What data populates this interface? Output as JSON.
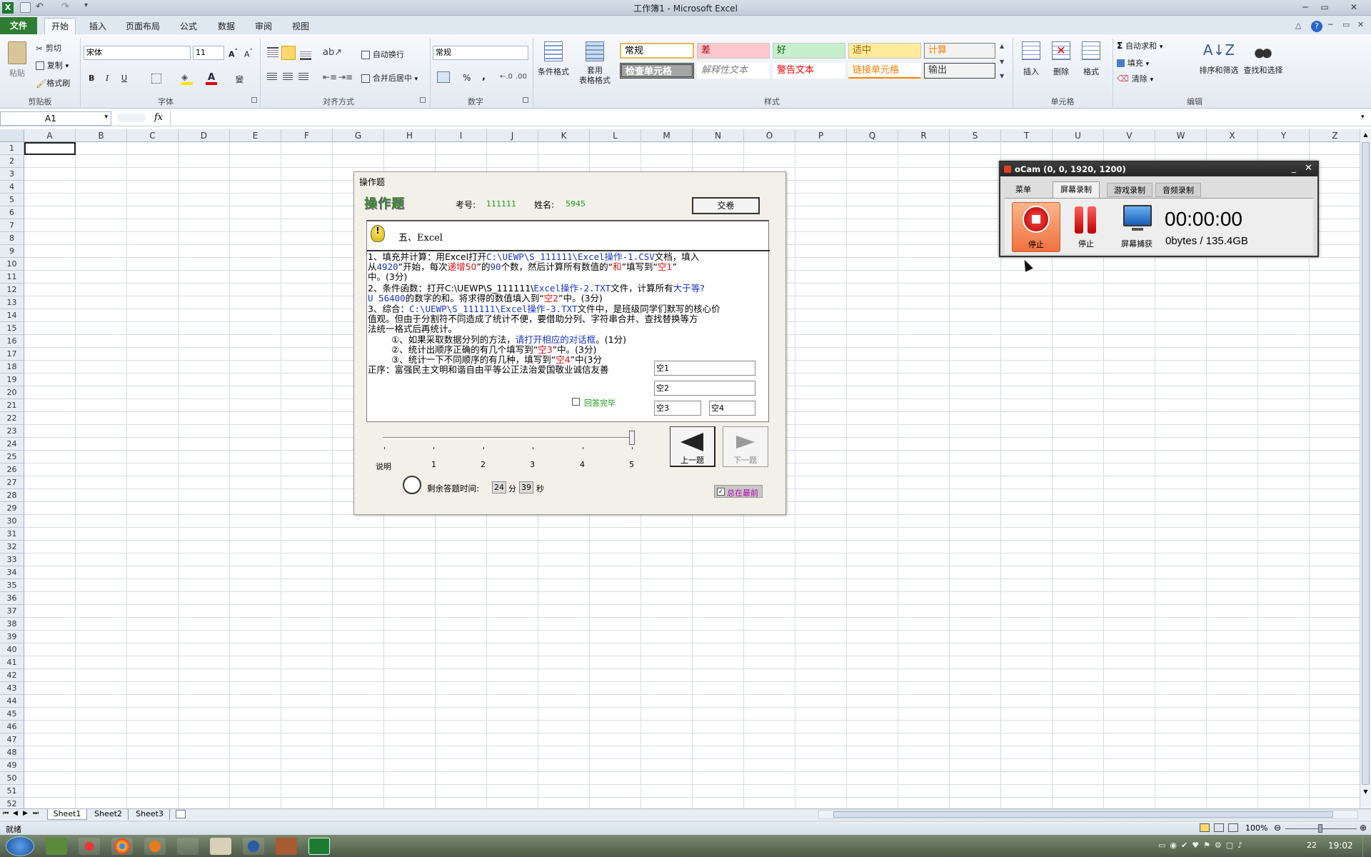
{
  "window": {
    "title": "工作簿1 - Microsoft Excel"
  },
  "ribbon": {
    "tabs": [
      "文件",
      "开始",
      "插入",
      "页面布局",
      "公式",
      "数据",
      "审阅",
      "视图"
    ],
    "clipboard": {
      "paste": "粘贴",
      "cut": "剪切",
      "copy": "复制",
      "format_painter": "格式刷",
      "label": "剪贴板"
    },
    "font": {
      "name": "宋体",
      "size": "11",
      "bold": "B",
      "italic": "I",
      "underline": "U",
      "label": "字体",
      "phonetic": "變"
    },
    "alignment": {
      "wrap": "自动换行",
      "merge": "合并后居中",
      "label": "对齐方式"
    },
    "number": {
      "format": "常规",
      "percent": "%",
      "comma": ",",
      "label": "数字"
    },
    "styles": {
      "conditional": "条件格式",
      "table": "套用\n表格格式",
      "cells": [
        "常规",
        "差",
        "好",
        "适中",
        "计算",
        "检查单元格",
        "解释性文本",
        "警告文本",
        "链接单元格",
        "输出"
      ],
      "label": "样式"
    },
    "cells_group": {
      "insert": "插入",
      "delete": "删除",
      "format": "格式",
      "label": "单元格"
    },
    "editing": {
      "autosum": "自动求和",
      "fill": "填充",
      "clear": "清除",
      "sort": "排序和筛选",
      "find": "查找和选择",
      "label": "编辑"
    }
  },
  "formula_bar": {
    "name_box": "A1",
    "fx": "fx",
    "content": ""
  },
  "grid": {
    "columns": [
      "A",
      "B",
      "C",
      "D",
      "E",
      "F",
      "G",
      "H",
      "I",
      "J",
      "K",
      "L",
      "M",
      "N",
      "O",
      "P",
      "Q",
      "R",
      "S",
      "T",
      "U",
      "V",
      "W",
      "X",
      "Y",
      "Z"
    ],
    "rows": [
      "1",
      "2",
      "3",
      "4",
      "5",
      "6",
      "7",
      "8",
      "9",
      "10",
      "11",
      "12",
      "13",
      "14",
      "15",
      "16",
      "17",
      "18",
      "19",
      "20",
      "21",
      "22",
      "23",
      "24",
      "25",
      "26",
      "27",
      "28",
      "29",
      "30",
      "31",
      "32",
      "33",
      "34",
      "35",
      "36",
      "37",
      "38",
      "39",
      "40",
      "41",
      "42",
      "43",
      "44",
      "45",
      "46",
      "47",
      "48",
      "49",
      "50",
      "51",
      "52"
    ]
  },
  "sheets": [
    "Sheet1",
    "Sheet2",
    "Sheet3"
  ],
  "status": {
    "ready": "就绪",
    "zoom": "100%"
  },
  "taskbar": {
    "clock": "19:02",
    "tray_num": "22"
  },
  "exam_dialog": {
    "title": "操作题",
    "logo": "操作题",
    "exam_no_label": "考号:",
    "exam_no": "111111",
    "name_label": "姓名:",
    "name": "5945",
    "submit": "交卷",
    "section": "五、Excel",
    "q1a": "1、填充并计算：用Excel打开",
    "q1a_path": "C:\\UEWP\\S_111111\\Excel操作-1.CSV",
    "q1a_tail": "文档，填入",
    "q1b_1": "从",
    "q1b_num": "4920",
    "q1b_2": "”开始，每次",
    "q1b_inc": "递增50",
    "q1b_3": "”的",
    "q1b_count": "90",
    "q1b_4": "个数，然后计算所有数值的“",
    "q1b_sum": "和",
    "q1b_5": "”填写到“",
    "q1b_blank": "空1",
    "q1b_6": "”",
    "q1c": "中。(3分)",
    "q2a": "2、条件函数：打开C:\\UEWP\\S_111111\\",
    "q2a_file": "Excel操作-2.TXT",
    "q2a_mid": "文件，计算所有",
    "q2a_cond": "大于等?",
    "q2b_val": "U 56400",
    "q2b_mid": "的数字的和。将求得的数值填入到“",
    "q2b_blank": "空2",
    "q2b_tail": "”中。(3分)",
    "q3a": "3、综合：",
    "q3a_path": "C:\\UEWP\\S_111111\\Excel操作-3.TXT",
    "q3a_tail": "文件中，是班级同学们默写的核心价",
    "q3b": "值观。但由于分割符不同造成了统计不便，要借助分列、字符串合并、查找替换等方",
    "q3c": "法统一格式后再统计。",
    "q3d_1": "①、如果采取数据分列的方法，",
    "q3d_hint": "请打开相应的对话框",
    "q3d_2": "。(1分)",
    "q3e_1": "②、统计出顺序正确的有几个填写到“",
    "q3e_blank": "空3",
    "q3e_2": "”中。(3分)",
    "q3f_1": "③、统计一下不同顺序的有几种，填写到“",
    "q3f_blank": "空4",
    "q3f_2": "”中(3分",
    "q3g": "正序：富强民主文明和谐自由平等公正法治爱国敬业诚信友善",
    "fields": [
      "空1",
      "空2",
      "空3",
      "空4"
    ],
    "answered": "回答完毕",
    "slider_labels": [
      "说明",
      "1",
      "2",
      "3",
      "4",
      "5"
    ],
    "slider_value": 5,
    "prev": "上一题",
    "next": "下一题",
    "timer_label": "剩余答题时间:",
    "minutes": "24",
    "min_unit": "分",
    "seconds": "39",
    "sec_unit": "秒",
    "always_top": "总在最前"
  },
  "ocam": {
    "title": "oCam (0, 0, 1920, 1200)",
    "tabs": [
      "菜单",
      "屏幕录制",
      "游戏录制",
      "音频录制"
    ],
    "stop": "停止",
    "pause": "停止",
    "capture": "屏幕捕获",
    "time": "00:00:00",
    "size": "0bytes / 135.4GB"
  }
}
